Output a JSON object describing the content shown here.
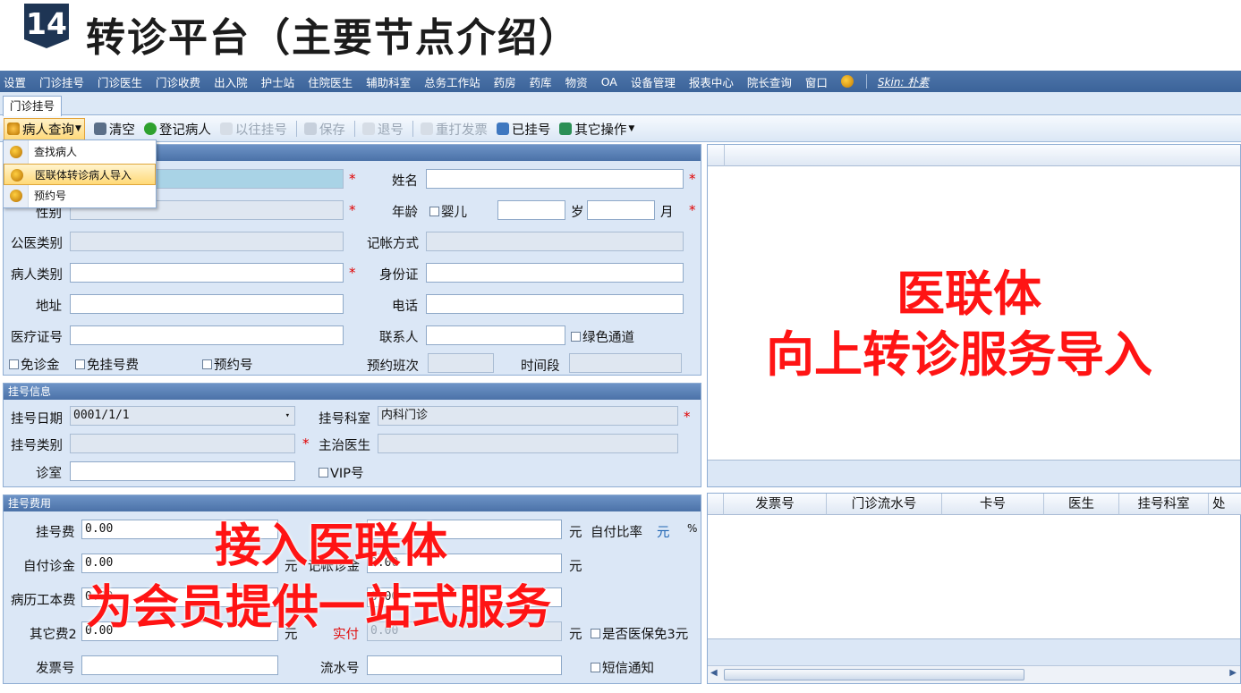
{
  "slide": {
    "number": "14",
    "title": "转诊平台（主要节点介绍）"
  },
  "menubar": {
    "items": [
      "设置",
      "门诊挂号",
      "门诊医生",
      "门诊收费",
      "出入院",
      "护士站",
      "住院医生",
      "辅助科室",
      "总务工作站",
      "药房",
      "药库",
      "物资",
      "OA",
      "设备管理",
      "报表中心",
      "院长查询",
      "窗口"
    ],
    "skin_label": "Skin: 朴素"
  },
  "tabs": {
    "active": "门诊挂号"
  },
  "toolbar": {
    "patient_query": "病人查询",
    "clear": "清空",
    "register_patient": "登记病人",
    "previous_registration": "以往挂号",
    "save": "保存",
    "cancel_number": "退号",
    "reprint_invoice": "重打发票",
    "registered": "已挂号",
    "other_ops": "其它操作"
  },
  "popup_menu": {
    "items": [
      "查找病人",
      "医联体转诊病人导入",
      "预约号"
    ],
    "highlighted_index": 1
  },
  "patient_info": {
    "name_label": "姓名",
    "gender_label": "性别",
    "age_label": "年龄",
    "infant_label": "婴儿",
    "year_unit": "岁",
    "month_unit": "月",
    "public_medical_label": "公医类别",
    "accounting_mode_label": "记帐方式",
    "patient_type_label": "病人类别",
    "id_card_label": "身份证",
    "address_label": "地址",
    "phone_label": "电话",
    "medical_cert_label": "医疗证号",
    "contact_label": "联系人",
    "green_channel_label": "绿色通道",
    "free_consult_label": "免诊金",
    "free_reg_fee_label": "免挂号费",
    "appointment_label": "预约号",
    "appointment_shift_label": "预约班次",
    "time_slot_label": "时间段"
  },
  "registration_info": {
    "title": "挂号信息",
    "date_label": "挂号日期",
    "date_value": "0001/1/1",
    "dept_label": "挂号科室",
    "dept_value": "内科门诊",
    "type_label": "挂号类别",
    "doctor_label": "主治医生",
    "room_label": "诊室",
    "vip_label": "VIP号"
  },
  "registration_fee": {
    "title": "挂号费用",
    "reg_fee_label": "挂号费",
    "reg_fee_value": "0.00",
    "self_ratio_label": "自付比率",
    "yuan": "元",
    "percent": "%",
    "self_consult_label": "自付诊金",
    "self_consult_value": "0.00",
    "acct_consult_label": "记帐诊金",
    "acct_consult_value": "0.00",
    "record_book_label": "病历工本费",
    "record_book_value": "0.00",
    "card_fee_value": "0.00",
    "other_fee_label": "其它费2",
    "other_fee_value": "0.00",
    "actual_pay_label": "实付",
    "actual_pay_value": "0.00",
    "insurance_exempt_label": "是否医保免3元",
    "invoice_label": "发票号",
    "serial_label": "流水号",
    "sms_label": "短信通知"
  },
  "grid": {
    "columns": [
      "发票号",
      "门诊流水号",
      "卡号",
      "医生",
      "挂号科室",
      "处"
    ]
  },
  "overlay": {
    "right_line1": "医联体",
    "right_line2": "向上转诊服务导入",
    "bottom_line1": "接入医联体",
    "bottom_line2": "为会员提供一站式服务"
  },
  "colors": {
    "accent_red": "#ff1414",
    "menubar_blue": "#4a70a6",
    "panel_bg": "#dbe7f6"
  }
}
